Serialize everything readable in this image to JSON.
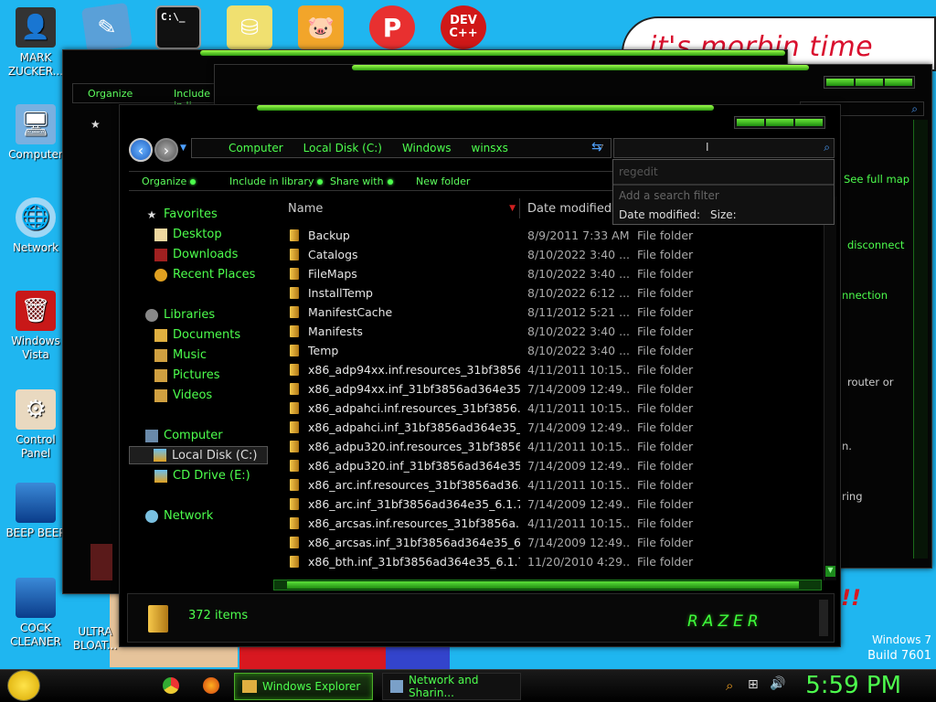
{
  "wallpaper": {
    "bubble_text": "it's morbin time",
    "os_name": "Windows 7",
    "build": "Build 7601"
  },
  "desktop_icons": [
    {
      "label": "MARK ZUCKER...",
      "icon": "person-icon"
    },
    {
      "label": "Computer",
      "icon": "computer-icon"
    },
    {
      "label": "Network",
      "icon": "network-icon"
    },
    {
      "label": "Windows Vista",
      "icon": "recycle-bin-icon"
    },
    {
      "label": "Control Panel",
      "icon": "control-panel-icon"
    },
    {
      "label": "BEEP BEEP",
      "icon": "blue-file-icon"
    },
    {
      "label": "COCK CLEANER",
      "icon": "blue-file-icon"
    },
    {
      "label": "ULTRA BLOAT...",
      "icon": "app-icon"
    }
  ],
  "top_icons": [
    {
      "name": "notepad-icon"
    },
    {
      "name": "cmd-icon",
      "label": "C:\\_"
    },
    {
      "name": "drive-icon"
    },
    {
      "name": "angry-birds-icon"
    },
    {
      "name": "photoscape-icon",
      "label": "P"
    },
    {
      "name": "devcpp-icon",
      "label": "DEV C++"
    }
  ],
  "back_window": {
    "toolbar": [
      "Organize",
      "Include in li"
    ],
    "right_texts": [
      "See full map",
      "disconnect",
      "nnection",
      "router or",
      "n.",
      "ring"
    ]
  },
  "explorer": {
    "breadcrumb": [
      "Computer",
      "Local Disk (C:)",
      "Windows",
      "winsxs"
    ],
    "commands": [
      "Organize",
      "Include in library",
      "Share with",
      "New folder"
    ],
    "search_dropdown": {
      "query": "regedit",
      "filter_placeholder": "Add a search filter",
      "filters": [
        "Date modified:",
        "Size:"
      ]
    },
    "nav": {
      "favorites": "Favorites",
      "favorites_items": [
        "Desktop",
        "Downloads",
        "Recent Places"
      ],
      "libraries": "Libraries",
      "libraries_items": [
        "Documents",
        "Music",
        "Pictures",
        "Videos"
      ],
      "computer": "Computer",
      "computer_items": [
        "Local Disk (C:)",
        "CD Drive (E:)"
      ],
      "network": "Network"
    },
    "columns": [
      "Name",
      "Date modified"
    ],
    "files": [
      {
        "name": "Backup",
        "date": "8/9/2011 7:33 AM",
        "type": "File folder"
      },
      {
        "name": "Catalogs",
        "date": "8/10/2022 3:40 ...",
        "type": "File folder"
      },
      {
        "name": "FileMaps",
        "date": "8/10/2022 3:40 ...",
        "type": "File folder"
      },
      {
        "name": "InstallTemp",
        "date": "8/10/2022 6:12 ...",
        "type": "File folder"
      },
      {
        "name": "ManifestCache",
        "date": "8/11/2012 5:21 ...",
        "type": "File folder"
      },
      {
        "name": "Manifests",
        "date": "8/10/2022 3:40 ...",
        "type": "File folder"
      },
      {
        "name": "Temp",
        "date": "8/10/2022 3:40 ...",
        "type": "File folder"
      },
      {
        "name": "x86_adp94xx.inf.resources_31bf3856...",
        "date": "4/11/2011 10:15...",
        "type": "File folder"
      },
      {
        "name": "x86_adp94xx.inf_31bf3856ad364e35...",
        "date": "7/14/2009 12:49...",
        "type": "File folder"
      },
      {
        "name": "x86_adpahci.inf.resources_31bf3856...",
        "date": "4/11/2011 10:15...",
        "type": "File folder"
      },
      {
        "name": "x86_adpahci.inf_31bf3856ad364e35_...",
        "date": "7/14/2009 12:49...",
        "type": "File folder"
      },
      {
        "name": "x86_adpu320.inf.resources_31bf3856...",
        "date": "4/11/2011 10:15...",
        "type": "File folder"
      },
      {
        "name": "x86_adpu320.inf_31bf3856ad364e35...",
        "date": "7/14/2009 12:49...",
        "type": "File folder"
      },
      {
        "name": "x86_arc.inf.resources_31bf3856ad36...",
        "date": "4/11/2011 10:15...",
        "type": "File folder"
      },
      {
        "name": "x86_arc.inf_31bf3856ad364e35_6.1.7...",
        "date": "7/14/2009 12:49...",
        "type": "File folder"
      },
      {
        "name": "x86_arcsas.inf.resources_31bf3856a...",
        "date": "4/11/2011 10:15...",
        "type": "File folder"
      },
      {
        "name": "x86_arcsas.inf_31bf3856ad364e35_6...",
        "date": "7/14/2009 12:49...",
        "type": "File folder"
      },
      {
        "name": "x86_bth.inf_31bf3856ad364e35_6.1.7...",
        "date": "11/20/2010 4:29...",
        "type": "File folder"
      }
    ],
    "item_count": "372 items",
    "brand": "RAZER"
  },
  "taskbar": {
    "windows": [
      {
        "label": "Windows Explorer",
        "active": true
      },
      {
        "label": "Network and Sharin...",
        "active": false
      }
    ],
    "pinned": [
      "chrome-icon",
      "firefox-icon"
    ],
    "time": "5:59 PM"
  },
  "colors": {
    "accent_green": "#4dff4d",
    "desktop_blue": "#1fb6f0",
    "window_bg": "#000000"
  }
}
